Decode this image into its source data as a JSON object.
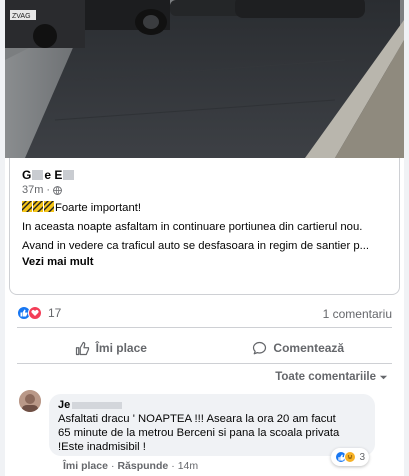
{
  "photo": {
    "plate_text": "ZVAG"
  },
  "post": {
    "author_name_visible_start": "G",
    "author_name_visible_mid": "e",
    "author_name_visible_end": "E",
    "time": "37m",
    "time_separator": "·",
    "line_title": "Foarte important!",
    "paragraph_1": "In aceasta noapte asfaltam in continuare portiunea din cartierul nou.",
    "paragraph_2": "Avand in vedere ca traficul auto se desfasoara in regim de santier p...",
    "see_more": "Vezi mai mult"
  },
  "reactions": {
    "count": "17",
    "comments": "1 comentariu"
  },
  "actions": {
    "like": "Îmi place",
    "comment": "Comentează"
  },
  "comments_sort": "Toate comentariile",
  "comment": {
    "author_visible": "Je",
    "text_line_1": "Asfaltati dracu ' NOAPTEA !!! Aseara la ora 20 am facut",
    "text_line_2": "65 minute de la metrou Berceni si pana la scoala privata",
    "text_line_3": "!Este inadmisibil !",
    "reactions_count": "3",
    "like": "Îmi place",
    "reply": "Răspunde",
    "time": "14m",
    "separator": "·"
  },
  "colors": {
    "facebook_blue": "#1877f2",
    "love_red": "#f33e58",
    "wow_yellow": "#f7b125",
    "meta_gray": "#65676b"
  }
}
